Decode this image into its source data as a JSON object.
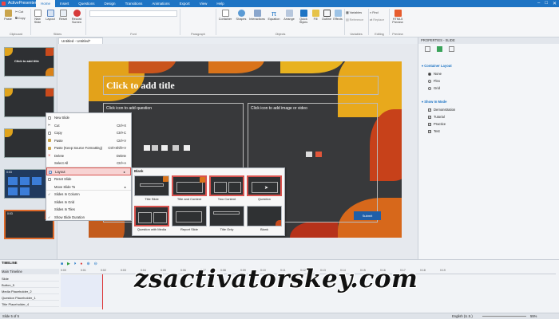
{
  "app": {
    "title": "ActivePresenter",
    "doc_tab": "Untitled - Untitled*"
  },
  "tabs": [
    "Home",
    "Insert",
    "Questions",
    "Design",
    "Transitions",
    "Animations",
    "Export",
    "View",
    "Help"
  ],
  "ribbon": {
    "clipboard": {
      "paste": "Paste",
      "cut": "Cut",
      "copy": "Copy",
      "group": "Clipboard"
    },
    "slides": {
      "new_slide": "New Slide",
      "layout": "Layout",
      "reset": "Reset",
      "record": "Record Screen",
      "group": "Slides"
    },
    "font_group": "Font",
    "paragraph_group": "Paragraph",
    "objects": {
      "container": "Container",
      "shapes": "Shapes",
      "interactions": "Interactions",
      "equation": "Equation",
      "arrange": "Arrange",
      "quick_styles": "Quick Styles",
      "fill": "Fill",
      "outline": "Outline",
      "effects": "Effects",
      "group": "Objects"
    },
    "variables": {
      "variables": "Variables",
      "reference": "Reference",
      "group": "Variables"
    },
    "editing": {
      "find": "Find",
      "replace": "Replace",
      "group": "Editing"
    },
    "preview": {
      "html5": "HTML5 Preview",
      "group": "Preview"
    }
  },
  "slide": {
    "title_placeholder": "Click to add title",
    "question_placeholder": "Click icon to add question",
    "media_placeholder": "Click icon to add image or video",
    "submit_label": "Submit"
  },
  "thumbs": [
    {
      "num": "1",
      "time": "0:03",
      "caption": "Click to add title"
    },
    {
      "num": "2",
      "time": "0:03"
    },
    {
      "num": "3",
      "time": "0:03"
    },
    {
      "num": "4",
      "time": "0:03"
    },
    {
      "num": "5",
      "time": "0:03"
    }
  ],
  "context_menu": [
    {
      "label": "New Slide",
      "shortcut": "",
      "icon": "new-slide-icon"
    },
    {
      "label": "Cut",
      "shortcut": "Ctrl+X",
      "icon": "cut-icon"
    },
    {
      "label": "Copy",
      "shortcut": "Ctrl+C",
      "icon": "copy-icon"
    },
    {
      "label": "Paste",
      "shortcut": "Ctrl+V",
      "icon": "paste-icon"
    },
    {
      "label": "Paste (Keep Source Formatting)",
      "shortcut": "Ctrl+Shift+V",
      "icon": "paste-keep-icon"
    },
    {
      "label": "Delete",
      "shortcut": "Delete",
      "icon": "delete-icon"
    },
    {
      "label": "Select All",
      "shortcut": "Ctrl+A",
      "icon": ""
    },
    {
      "label": "Layout",
      "shortcut": "▸",
      "icon": "layout-icon"
    },
    {
      "label": "Reset Slide",
      "shortcut": "",
      "icon": "reset-icon"
    },
    {
      "label": "Move Slide To",
      "shortcut": "▸",
      "icon": ""
    },
    {
      "label": "Slides In Column",
      "shortcut": "",
      "icon": ""
    },
    {
      "label": "Slides In Grid",
      "shortcut": "",
      "icon": ""
    },
    {
      "label": "Slides In Tiles",
      "shortcut": "",
      "icon": ""
    },
    {
      "label": "Show Slide Duration",
      "shortcut": "",
      "icon": ""
    }
  ],
  "layout_menu": {
    "header": "Blank",
    "items": [
      "Title Slide",
      "Title and Content",
      "Two Content",
      "Question",
      "Question with Media",
      "Report Slide",
      "Title Only",
      "Blank"
    ]
  },
  "properties": {
    "header": "PROPERTIES - SLIDE",
    "container_layout": {
      "label": "Container Layout",
      "options": [
        "None",
        "Flex",
        "Grid"
      ],
      "selected": "None"
    },
    "show_in_mode": {
      "label": "Show In Mode",
      "options": [
        "Demonstration",
        "Tutorial",
        "Practice",
        "Test"
      ]
    }
  },
  "timeline": {
    "header": "TIMELINE",
    "track_label": "Main Timeline",
    "rows": [
      "Slide",
      "Button_5",
      "Media Placeholder_2",
      "Question Placeholder_1",
      "Title Placeholder_4"
    ],
    "ticks": [
      "0:00",
      "0:01",
      "0:02",
      "0:03",
      "0:04",
      "0:05",
      "0:06",
      "0:07",
      "0:08",
      "0:09",
      "0:10",
      "0:11",
      "0:12",
      "0:13",
      "0:14",
      "0:15",
      "0:16",
      "0:17",
      "0:18",
      "0:19"
    ]
  },
  "status": {
    "slide": "Slide 5 of 5",
    "language": "English (U.S.)",
    "zoom": "55%"
  },
  "watermark": "zsactivatorskey.com",
  "colors": {
    "accent": "#1e74c4",
    "highlight": "#d9534f",
    "slide_bg": "#38393b",
    "selected_thumb": "#e06a2a"
  }
}
